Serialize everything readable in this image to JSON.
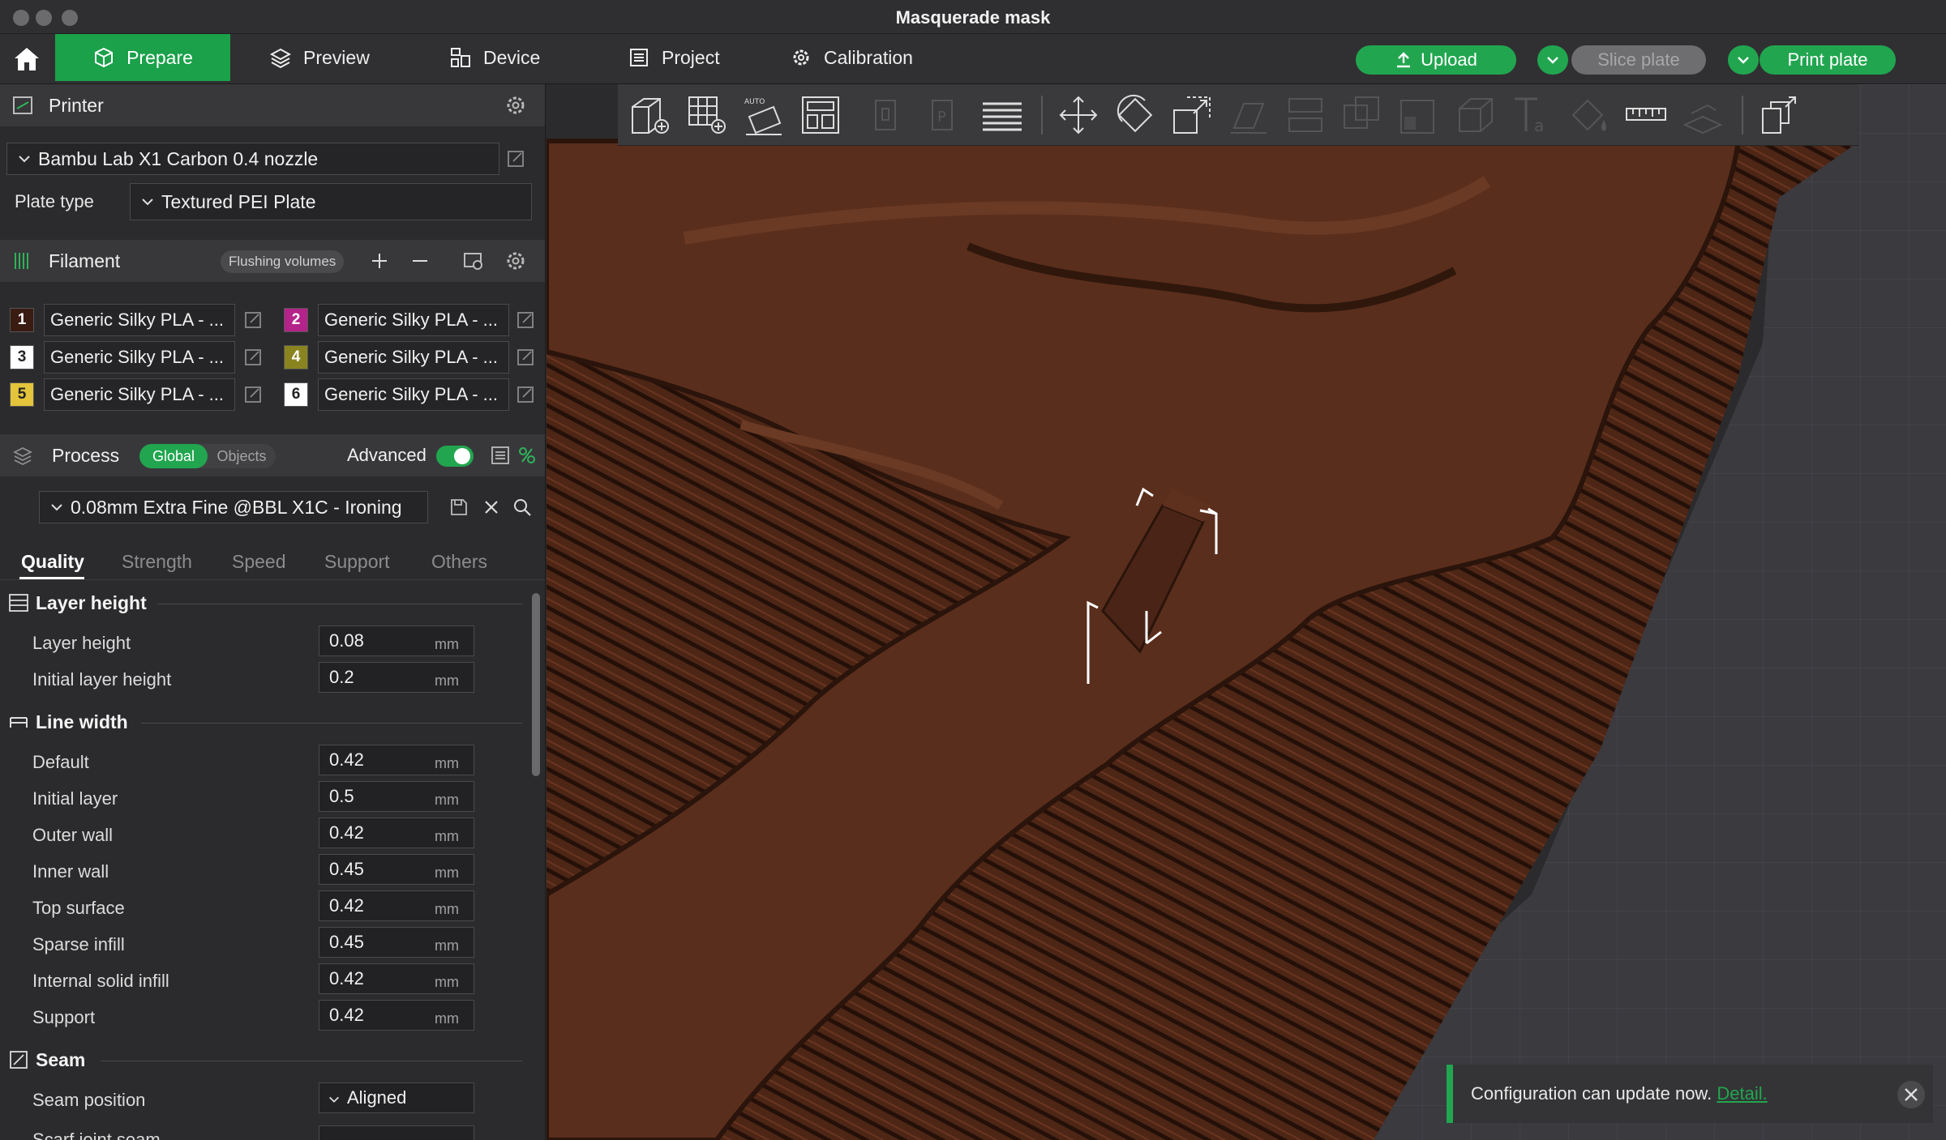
{
  "window": {
    "title": "Masquerade mask"
  },
  "nav": {
    "tabs": [
      {
        "label": "Prepare",
        "icon": "cube-icon",
        "active": true
      },
      {
        "label": "Preview",
        "icon": "layers-icon"
      },
      {
        "label": "Device",
        "icon": "device-icon"
      },
      {
        "label": "Project",
        "icon": "project-icon"
      },
      {
        "label": "Calibration",
        "icon": "gear-icon"
      }
    ],
    "upload_label": "Upload",
    "slice_label": "Slice plate",
    "print_label": "Print plate"
  },
  "printer": {
    "section_title": "Printer",
    "selected": "Bambu Lab X1 Carbon 0.4 nozzle",
    "plate_type_label": "Plate type",
    "plate_type_value": "Textured PEI Plate"
  },
  "filament": {
    "section_title": "Filament",
    "flushing_label": "Flushing volumes",
    "slots": [
      {
        "num": "1",
        "name": "Generic Silky PLA - ...",
        "color": "#3a1c12",
        "text_color": "#ffffff"
      },
      {
        "num": "2",
        "name": "Generic Silky PLA - ...",
        "color": "#b4238a",
        "text_color": "#ffffff"
      },
      {
        "num": "3",
        "name": "Generic Silky PLA - ...",
        "color": "#ffffff",
        "text_color": "#222222"
      },
      {
        "num": "4",
        "name": "Generic Silky PLA - ...",
        "color": "#8a8420",
        "text_color": "#ffffff"
      },
      {
        "num": "5",
        "name": "Generic Silky PLA - ...",
        "color": "#e3c43a",
        "text_color": "#222222"
      },
      {
        "num": "6",
        "name": "Generic Silky PLA - ...",
        "color": "#ffffff",
        "text_color": "#222222"
      }
    ]
  },
  "process": {
    "section_title": "Process",
    "global_label": "Global",
    "objects_label": "Objects",
    "advanced_label": "Advanced",
    "advanced_on": true,
    "profile": "0.08mm Extra Fine @BBL X1C - Ironing",
    "tabs": [
      "Quality",
      "Strength",
      "Speed",
      "Support",
      "Others"
    ],
    "active_tab": "Quality"
  },
  "quality": {
    "layer_height_group": "Layer height",
    "line_width_group": "Line width",
    "seam_group": "Seam",
    "unit": "mm",
    "layer_height": [
      {
        "label": "Layer height",
        "value": "0.08"
      },
      {
        "label": "Initial layer height",
        "value": "0.2"
      }
    ],
    "line_width": [
      {
        "label": "Default",
        "value": "0.42"
      },
      {
        "label": "Initial layer",
        "value": "0.5"
      },
      {
        "label": "Outer wall",
        "value": "0.42"
      },
      {
        "label": "Inner wall",
        "value": "0.45"
      },
      {
        "label": "Top surface",
        "value": "0.42"
      },
      {
        "label": "Sparse infill",
        "value": "0.45"
      },
      {
        "label": "Internal solid infill",
        "value": "0.42"
      },
      {
        "label": "Support",
        "value": "0.42"
      }
    ],
    "seam_position_label": "Seam position",
    "seam_position_value": "Aligned",
    "scarf_label": "Scarf joint seam"
  },
  "notification": {
    "message": "Configuration can update now.",
    "link": "Detail."
  },
  "colors": {
    "accent": "#21a64f",
    "model": "#5a2e1c",
    "bed": "#3a3a3f"
  }
}
